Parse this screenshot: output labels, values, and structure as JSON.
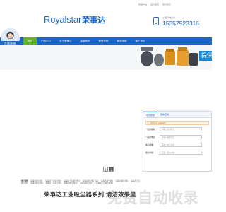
{
  "util_links": [
    "收藏本站",
    "设为首页",
    "联系我们"
  ],
  "header": {
    "logo_en": "Royalstar",
    "logo_cn": "荣事达",
    "hotline_label": "全国咨询热线",
    "hotline_number": "15357923316"
  },
  "avatar": {
    "badge": "在线客服"
  },
  "nav": {
    "items": [
      {
        "label": "首页",
        "active": true
      },
      {
        "label": "产品中心",
        "active": false
      },
      {
        "label": "关于荣事达",
        "active": false
      },
      {
        "label": "新闻资讯",
        "active": false
      },
      {
        "label": "荣誉资质",
        "active": false
      },
      {
        "label": "服务网络",
        "active": false
      },
      {
        "label": "客户评价",
        "active": false
      }
    ]
  },
  "banner": {
    "promo_text": "提供"
  },
  "pager": {
    "pages": [
      "1",
      "2"
    ],
    "active_index": 1
  },
  "links": {
    "label": "热门推荐",
    "items": [
      "荣事达吸尘器1",
      "荣事达工业吸尘器2",
      "荣事达工业吸尘器3",
      "荣事达吸尘器厂家4",
      "荣事达吸尘器5",
      "荣事达吸尘器6",
      "荣事达工业吸尘器7",
      "荣事达吸尘器8",
      "荣事达工业吸尘器9",
      "荣事达吸尘器10",
      "荣事达吸尘器11",
      "荣事达工业吸尘器12"
    ]
  },
  "footer": {
    "title": "荣事达工业吸尘器系列 清洁效果显"
  },
  "watermark": "免费自动收录",
  "form": {
    "tabs": [
      {
        "label": "在线留言",
        "active": true
      },
      {
        "label": "微信咨询",
        "active": false
      }
    ],
    "notice": "填写信息 获取报价",
    "fields": [
      {
        "label": "* 您的姓名",
        "placeholder": "请输入您的姓名"
      },
      {
        "label": "* 联系电话",
        "placeholder": "请输入联系电话"
      },
      {
        "label": "电子邮箱",
        "placeholder": "请输入电子邮箱"
      },
      {
        "label": "留言内容",
        "placeholder": "请输入留言内容"
      }
    ]
  },
  "colors": {
    "brand_blue": "#1a66c8",
    "nav_active_green": "#64b22c"
  }
}
